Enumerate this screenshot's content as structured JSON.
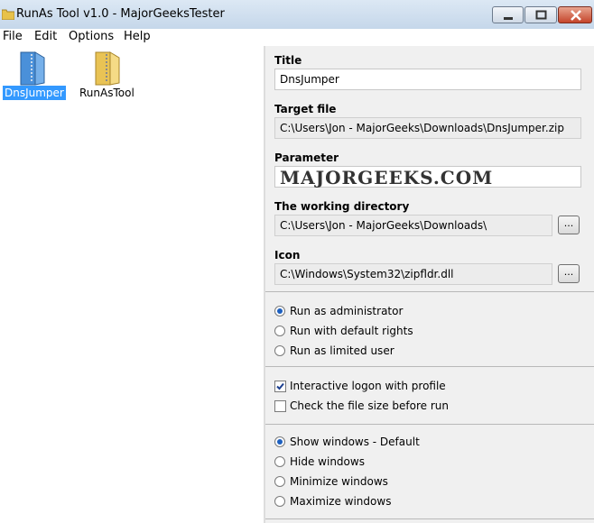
{
  "window": {
    "title": "RunAs Tool v1.0 - MajorGeeksTester",
    "icon": "folder-icon",
    "controls": [
      "minimize-icon",
      "maximize-icon",
      "close-icon"
    ]
  },
  "menu": [
    "File",
    "Edit",
    "Options",
    "Help"
  ],
  "files": [
    {
      "label": "DnsJumper",
      "icon": "zip-folder-blue-icon",
      "selected": true
    },
    {
      "label": "RunAsTool",
      "icon": "zip-folder-yellow-icon",
      "selected": false
    }
  ],
  "form": {
    "title_label": "Title",
    "title_value": "DnsJumper",
    "target_label": "Target file",
    "target_value": "C:\\Users\\Jon - MajorGeeks\\Downloads\\DnsJumper.zip",
    "parameter_label": "Parameter",
    "parameter_value": "",
    "watermark": "MAJORGEEKS.COM",
    "workdir_label": "The working directory",
    "workdir_value": "C:\\Users\\Jon - MajorGeeks\\Downloads\\",
    "icon_label": "Icon",
    "icon_value": "C:\\Windows\\System32\\zipfldr.dll",
    "browse_label": "..."
  },
  "run_mode": {
    "options": [
      "Run as administrator",
      "Run with default rights",
      "Run as limited user"
    ],
    "selected": 0
  },
  "checks": [
    {
      "label": "Interactive logon with profile",
      "checked": true
    },
    {
      "label": "Check the file size before run",
      "checked": false
    }
  ],
  "window_mode": {
    "options": [
      "Show windows - Default",
      "Hide windows",
      "Minimize windows",
      "Maximize windows"
    ],
    "selected": 0
  },
  "colors": {
    "selection": "#3399ff",
    "panel": "#f0f0f0",
    "radio_dot": "#1c5fbf"
  }
}
